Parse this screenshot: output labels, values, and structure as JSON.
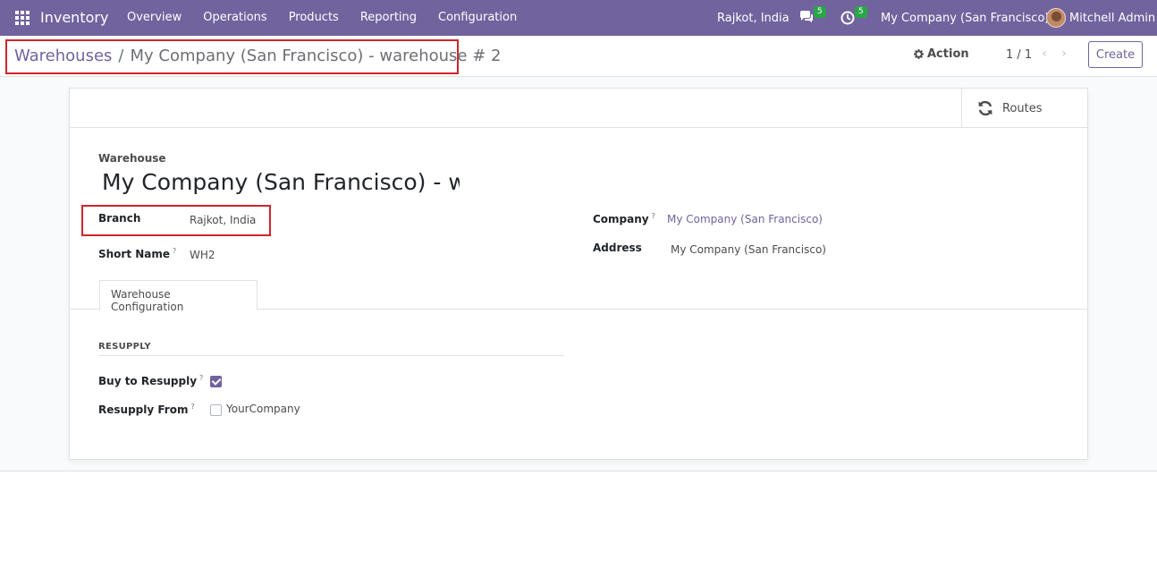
{
  "navbar": {
    "app_name": "Inventory",
    "menu": [
      "Overview",
      "Operations",
      "Products",
      "Reporting",
      "Configuration"
    ],
    "branch": "Rajkot, India",
    "messages_count": "5",
    "activities_count": "5",
    "company": "My Company (San Francisco)",
    "user": "Mitchell Admin",
    "accent_color": "#71639e",
    "badge_color": "#28a745"
  },
  "control_panel": {
    "breadcrumb_root": "Warehouses",
    "breadcrumb_sep": "/",
    "breadcrumb_current": "My Company (San Francisco) - warehouse # 2",
    "action_label": "Action",
    "pager": "1 / 1",
    "create_label": "Create"
  },
  "form": {
    "routes_label": "Routes",
    "warehouse_label": "Warehouse",
    "warehouse_name": "My Company (San Francisco) - warehouse # 2",
    "branch_label": "Branch",
    "branch_value": "Rajkot, India",
    "short_name_label": "Short Name",
    "short_name_value": "WH2",
    "company_label": "Company",
    "company_value": "My Company (San Francisco)",
    "address_label": "Address",
    "address_value": "My Company (San Francisco)",
    "help_mark": "?",
    "tab_label": "Warehouse Configuration",
    "group_title": "RESUPPLY",
    "buy_to_resupply_label": "Buy to Resupply",
    "buy_to_resupply_checked": true,
    "resupply_from_label": "Resupply From",
    "resupply_from_option": "YourCompany",
    "resupply_from_checked": false
  }
}
